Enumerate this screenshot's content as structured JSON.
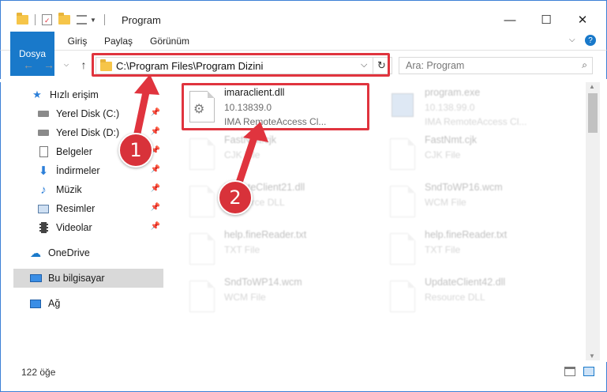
{
  "window": {
    "title": "Program",
    "minimize": "—",
    "maximize": "☐",
    "close": "✕"
  },
  "ribbon": {
    "tabs": [
      "Dosya",
      "Giriş",
      "Paylaş",
      "Görünüm"
    ]
  },
  "address": {
    "path": "C:\\Program Files\\Program Dizini",
    "search_placeholder": "Ara: Program"
  },
  "sidebar": {
    "items": [
      {
        "label": "Hızlı erişim",
        "icon": "star-icon"
      },
      {
        "label": "Yerel Disk (C:)",
        "icon": "drive-icon"
      },
      {
        "label": "Yerel Disk (D:)",
        "icon": "drive-icon"
      },
      {
        "label": "Belgeler",
        "icon": "documents-icon"
      },
      {
        "label": "İndirmeler",
        "icon": "download-icon"
      },
      {
        "label": "Müzik",
        "icon": "music-icon"
      },
      {
        "label": "Resimler",
        "icon": "pictures-icon"
      },
      {
        "label": "Videolar",
        "icon": "video-icon"
      },
      {
        "label": "OneDrive",
        "icon": "cloud-icon"
      },
      {
        "label": "Bu bilgisayar",
        "icon": "computer-icon"
      },
      {
        "label": "Ağ",
        "icon": "network-icon"
      }
    ]
  },
  "files": [
    {
      "name": "imaraclient.dll",
      "line2": "10.13839.0",
      "line3": "IMA RemoteAccess Cl...",
      "type": "dll"
    },
    {
      "name": "program.exe",
      "line2": "10.138.99.0",
      "line3": "IMA RemoteAccess Cl...",
      "type": "exe"
    },
    {
      "name": "FastNmt.cjk",
      "line2": "CJK File",
      "line3": "",
      "type": "doc"
    },
    {
      "name": "FastNmt.cjk",
      "line2": "CJK File",
      "line3": "",
      "type": "doc"
    },
    {
      "name": "UpdateClient21.dll",
      "line2": "Resource DLL",
      "line3": "",
      "type": "dll"
    },
    {
      "name": "SndToWP16.wcm",
      "line2": "WCM File",
      "line3": "",
      "type": "doc"
    },
    {
      "name": "help.fineReader.txt",
      "line2": "TXT File",
      "line3": "",
      "type": "doc"
    },
    {
      "name": "help.fineReader.txt",
      "line2": "TXT File",
      "line3": "",
      "type": "doc"
    },
    {
      "name": "SndToWP14.wcm",
      "line2": "WCM File",
      "line3": "",
      "type": "doc"
    },
    {
      "name": "UpdateClient42.dll",
      "line2": "Resource DLL",
      "line3": "",
      "type": "dll"
    }
  ],
  "status": {
    "count": "122 öğe"
  },
  "annotations": [
    "1",
    "2"
  ],
  "colors": {
    "accent": "#1979ca",
    "highlight": "#e0343e",
    "badge": "#d8323a"
  }
}
